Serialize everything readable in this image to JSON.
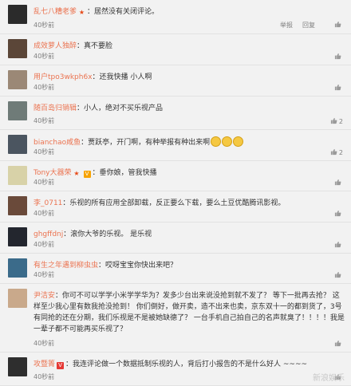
{
  "comments": [
    {
      "user": "乱七八糟老爹",
      "badges": [
        "star"
      ],
      "text": "居然没有关闭评论。",
      "time": "40秒前",
      "actions": [
        "举报",
        "回复"
      ],
      "likes": "",
      "avatar_color": "#2b2b2b"
    },
    {
      "user": "成效萝人独醉",
      "badges": [],
      "text": "真不要脸",
      "time": "40秒前",
      "actions": [],
      "likes": "",
      "avatar_color": "#5b4638"
    },
    {
      "user": "用户tpo3wkph6x",
      "badges": [],
      "text": "还我快播 小人啊",
      "time": "40秒前",
      "actions": [],
      "likes": "",
      "avatar_color": "#9b8876"
    },
    {
      "user": "随百岛归销辑",
      "badges": [],
      "text": "小人，绝对不买乐视产品",
      "time": "40秒前",
      "actions": [],
      "likes": "2",
      "avatar_color": "#6f7b78"
    },
    {
      "user": "bianchao咸鱼",
      "badges": [],
      "text": "贾跃亭，开门啊，有种举报有种出来啊",
      "time": "40秒前",
      "actions": [],
      "likes": "2",
      "emojis": 3,
      "avatar_color": "#4b5560"
    },
    {
      "user": "Tony大器荣",
      "badges": [
        "star",
        "v"
      ],
      "text": "垂你娘，管我快播",
      "time": "40秒前",
      "actions": [],
      "likes": "",
      "avatar_color": "#d8d2a8"
    },
    {
      "user": "李_0711",
      "badges": [],
      "text": "乐视的所有应用全部卸载，反正要么下载，要么土豆优酷腾讯影视。",
      "time": "40秒前",
      "actions": [],
      "likes": "",
      "avatar_color": "#6a4a3a"
    },
    {
      "user": "ghgffdnj",
      "badges": [],
      "text": "滚你大爷的乐视。 是乐视",
      "time": "40秒前",
      "actions": [],
      "likes": "",
      "avatar_color": "#23262e"
    },
    {
      "user": "有生之年遇到柳虫虫",
      "badges": [],
      "text": "哎呀宝宝你快出来吧？",
      "time": "40秒前",
      "actions": [],
      "likes": "",
      "avatar_color": "#3b6b8a"
    },
    {
      "user": "尹洁安",
      "badges": [],
      "text": "你可不可以学学小米学学华为？发多少台出来说没抢到就不发了？ 等下一批再去抢？ 这样至少我心里有数我抢没抢到！ 你们倒好，做开卖，造不出来也卖，京东双十一的都到货了，3号有同抢的还在分期，我们乐视是不是被她缺德了？ 一台手机自己拍自己的名声就臭了！！！！我是一辈子都不可能再买乐视了？",
      "time": "40秒前",
      "actions": [],
      "likes": "",
      "avatar_color": "#c9a98b"
    },
    {
      "user": "攻暨箐",
      "badges": [
        "vip"
      ],
      "text": "我连评论做一个数据抵制乐视的人，背后打小报告的不是什么好人 ~~~~",
      "time": "40秒前",
      "actions": [],
      "likes": "",
      "avatar_color": "#2e2e2e"
    }
  ],
  "watermark": "新浪娱乐"
}
